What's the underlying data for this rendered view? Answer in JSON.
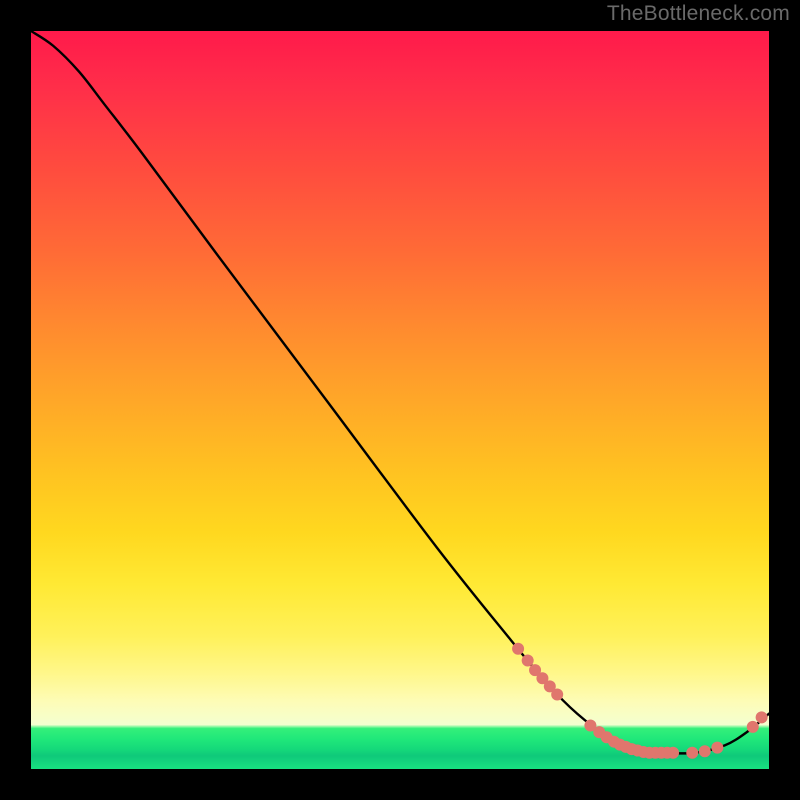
{
  "watermark": "TheBottleneck.com",
  "chart_data": {
    "type": "line",
    "title": "",
    "xlabel": "",
    "ylabel": "",
    "xlim": [
      0,
      100
    ],
    "ylim": [
      0,
      100
    ],
    "series": [
      {
        "name": "curve",
        "color": "#000000",
        "points": [
          {
            "x": 0.0,
            "y": 100.0
          },
          {
            "x": 3.0,
            "y": 98.0
          },
          {
            "x": 6.5,
            "y": 94.5
          },
          {
            "x": 10.0,
            "y": 90.0
          },
          {
            "x": 15.0,
            "y": 83.5
          },
          {
            "x": 25.0,
            "y": 70.0
          },
          {
            "x": 40.0,
            "y": 50.0
          },
          {
            "x": 55.0,
            "y": 30.0
          },
          {
            "x": 65.0,
            "y": 17.5
          },
          {
            "x": 70.0,
            "y": 11.5
          },
          {
            "x": 74.0,
            "y": 7.5
          },
          {
            "x": 78.0,
            "y": 4.5
          },
          {
            "x": 82.0,
            "y": 2.7
          },
          {
            "x": 86.0,
            "y": 2.2
          },
          {
            "x": 90.0,
            "y": 2.2
          },
          {
            "x": 94.0,
            "y": 3.2
          },
          {
            "x": 97.0,
            "y": 5.0
          },
          {
            "x": 100.0,
            "y": 7.5
          }
        ]
      }
    ],
    "markers": {
      "name": "highlight-points",
      "color": "#e0766d",
      "radius_px": 6,
      "points": [
        {
          "x": 66.0,
          "y": 16.3
        },
        {
          "x": 67.3,
          "y": 14.7
        },
        {
          "x": 68.3,
          "y": 13.4
        },
        {
          "x": 69.3,
          "y": 12.3
        },
        {
          "x": 70.3,
          "y": 11.2
        },
        {
          "x": 71.3,
          "y": 10.1
        },
        {
          "x": 75.8,
          "y": 5.9
        },
        {
          "x": 77.0,
          "y": 5.0
        },
        {
          "x": 78.0,
          "y": 4.3
        },
        {
          "x": 79.0,
          "y": 3.7
        },
        {
          "x": 79.8,
          "y": 3.3
        },
        {
          "x": 80.6,
          "y": 3.0
        },
        {
          "x": 81.4,
          "y": 2.7
        },
        {
          "x": 82.2,
          "y": 2.5
        },
        {
          "x": 83.0,
          "y": 2.3
        },
        {
          "x": 83.8,
          "y": 2.2
        },
        {
          "x": 84.6,
          "y": 2.2
        },
        {
          "x": 85.4,
          "y": 2.2
        },
        {
          "x": 86.2,
          "y": 2.2
        },
        {
          "x": 87.0,
          "y": 2.2
        },
        {
          "x": 89.6,
          "y": 2.2
        },
        {
          "x": 91.3,
          "y": 2.4
        },
        {
          "x": 93.0,
          "y": 2.9
        },
        {
          "x": 97.8,
          "y": 5.7
        },
        {
          "x": 99.0,
          "y": 7.0
        }
      ]
    }
  }
}
